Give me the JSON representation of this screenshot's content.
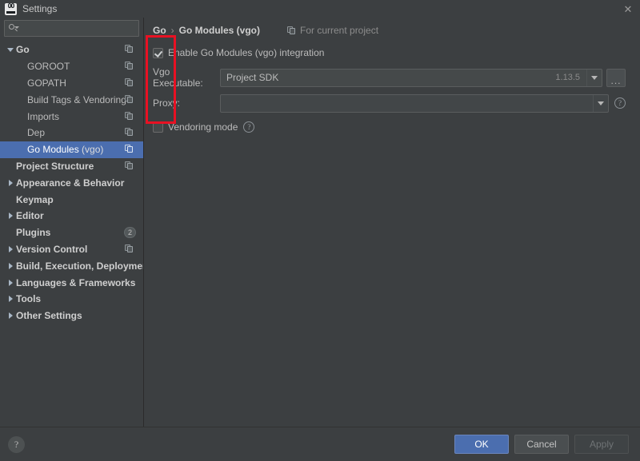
{
  "window": {
    "title": "Settings",
    "app_icon": "goland-logo-icon",
    "close_icon": "✕"
  },
  "search": {
    "value": "",
    "placeholder": ""
  },
  "sidebar": {
    "items": [
      {
        "label": "Go",
        "level": 0,
        "arrow": "down",
        "bold": true,
        "scope_icon": true,
        "selected": false,
        "badge": null
      },
      {
        "label": "GOROOT",
        "level": 1,
        "arrow": "none",
        "bold": false,
        "scope_icon": true,
        "selected": false,
        "badge": null
      },
      {
        "label": "GOPATH",
        "level": 1,
        "arrow": "none",
        "bold": false,
        "scope_icon": true,
        "selected": false,
        "badge": null
      },
      {
        "label": "Build Tags & Vendoring",
        "level": 1,
        "arrow": "none",
        "bold": false,
        "scope_icon": true,
        "selected": false,
        "badge": null
      },
      {
        "label": "Imports",
        "level": 1,
        "arrow": "none",
        "bold": false,
        "scope_icon": true,
        "selected": false,
        "badge": null
      },
      {
        "label": "Dep",
        "level": 1,
        "arrow": "none",
        "bold": false,
        "scope_icon": true,
        "selected": false,
        "badge": null
      },
      {
        "label": "Go Modules (vgo)",
        "level": 1,
        "arrow": "none",
        "bold": false,
        "scope_icon": true,
        "selected": true,
        "badge": null
      },
      {
        "label": "Project Structure",
        "level": 0,
        "arrow": "none",
        "bold": true,
        "scope_icon": true,
        "selected": false,
        "badge": null
      },
      {
        "label": "Appearance & Behavior",
        "level": 0,
        "arrow": "right",
        "bold": true,
        "scope_icon": false,
        "selected": false,
        "badge": null
      },
      {
        "label": "Keymap",
        "level": 0,
        "arrow": "none",
        "bold": true,
        "scope_icon": false,
        "selected": false,
        "badge": null
      },
      {
        "label": "Editor",
        "level": 0,
        "arrow": "right",
        "bold": true,
        "scope_icon": false,
        "selected": false,
        "badge": null
      },
      {
        "label": "Plugins",
        "level": 0,
        "arrow": "none",
        "bold": true,
        "scope_icon": false,
        "selected": false,
        "badge": "2"
      },
      {
        "label": "Version Control",
        "level": 0,
        "arrow": "right",
        "bold": true,
        "scope_icon": true,
        "selected": false,
        "badge": null
      },
      {
        "label": "Build, Execution, Deployment",
        "level": 0,
        "arrow": "right",
        "bold": true,
        "scope_icon": false,
        "selected": false,
        "badge": null
      },
      {
        "label": "Languages & Frameworks",
        "level": 0,
        "arrow": "right",
        "bold": true,
        "scope_icon": false,
        "selected": false,
        "badge": null
      },
      {
        "label": "Tools",
        "level": 0,
        "arrow": "right",
        "bold": true,
        "scope_icon": false,
        "selected": false,
        "badge": null
      },
      {
        "label": "Other Settings",
        "level": 0,
        "arrow": "right",
        "bold": true,
        "scope_icon": false,
        "selected": false,
        "badge": null
      }
    ]
  },
  "main": {
    "breadcrumb": {
      "root": "Go",
      "separator": "›",
      "current": "Go Modules (vgo)"
    },
    "scope_note": "For current project",
    "enable_checkbox": {
      "label": "Enable Go Modules (vgo) integration",
      "checked": true
    },
    "vgo_executable": {
      "label": "Vgo Executable:",
      "value": "Project SDK",
      "version": "1.13.5",
      "browse_label": "...",
      "arrow_icon": "chevron-down-icon"
    },
    "proxy": {
      "label": "Proxy:",
      "value": "",
      "arrow_icon": "chevron-down-icon",
      "help_icon": "?"
    },
    "vendoring": {
      "label": "Vendoring mode",
      "checked": false,
      "help_icon": "?"
    }
  },
  "footer": {
    "help_icon": "?",
    "ok_label": "OK",
    "cancel_label": "Cancel",
    "apply_label": "Apply"
  },
  "annotation": {
    "color": "#e81123",
    "shape": "rectangle"
  }
}
